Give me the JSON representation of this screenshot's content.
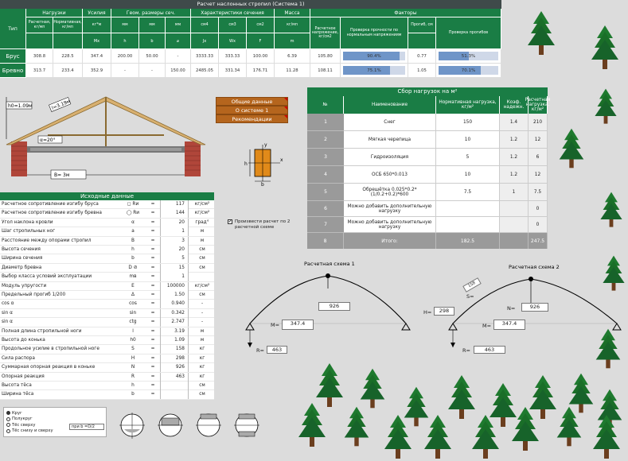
{
  "results": {
    "title": "Расчет наслонных стропил (Система 1)",
    "groups": [
      "Тип",
      "Нагрузки",
      "Усилия",
      "Геом. размеры сеч.",
      "Характеристики сечения",
      "Масса",
      "Факторы"
    ],
    "subheaders": [
      "Расчетная, кг/мп",
      "Нормативная, кг/мп",
      "кг*м",
      "мм",
      "мм",
      "мм",
      "см4",
      "см3",
      "см2",
      "кг/мп",
      "Расчетное напряжение, кг/см2",
      "Проверка прочности по нормальным напряжениям",
      "Прогиб, см",
      "Проверка прогибов"
    ],
    "units": [
      "",
      "",
      "Мх",
      "h",
      "b",
      "⌀",
      "Jx",
      "Wx",
      "F",
      "m",
      "",
      "",
      "",
      ""
    ],
    "rows": [
      {
        "type": "Брус",
        "cells": [
          "308.8",
          "228.5",
          "347.4",
          "200.00",
          "50.00",
          "-",
          "3333.33",
          "333.33",
          "100.00",
          "6.39",
          "105.80",
          "",
          "0.77",
          ""
        ],
        "stress_pct": "90.4%",
        "stress_value": 0.904,
        "defl_pct": "51.3%",
        "defl_value": 0.513
      },
      {
        "type": "Бревно",
        "cells": [
          "313.7",
          "233.4",
          "352.9",
          "-",
          "-",
          "150.00",
          "2485.05",
          "331.34",
          "176.71",
          "11.28",
          "108.11",
          "",
          "1.05",
          ""
        ],
        "stress_pct": "75.1%",
        "stress_value": 0.751,
        "defl_pct": "70.1%",
        "defl_value": 0.701
      }
    ]
  },
  "buttons": {
    "general": "Общие данные",
    "about": "О системе 1",
    "recommend": "Рекомендации"
  },
  "diagram": {
    "h0": "h0=1.09м",
    "l": "l=3.19м",
    "alpha": "α=20°",
    "b": "B= 3м"
  },
  "section": {
    "h": "h",
    "b": "b",
    "x": "x",
    "y": "y"
  },
  "inputs": {
    "title": "Исходные данные",
    "rows": [
      {
        "label": "Расчетное сопротивление изгибу бруса",
        "sym": "◻ Rи",
        "eq": "=",
        "val": "117",
        "unit": "кг/см²"
      },
      {
        "label": "Расчетное сопротивление изгибу бревна",
        "sym": "◯ Rи",
        "eq": "=",
        "val": "144",
        "unit": "кг/см²"
      },
      {
        "label": "Угол наклона кровли",
        "sym": "α",
        "eq": "=",
        "val": "20",
        "unit": "град°"
      },
      {
        "label": "Шаг стропильных ног",
        "sym": "а",
        "eq": "=",
        "val": "1",
        "unit": "м"
      },
      {
        "label": "Расстояние между опорами стропил",
        "sym": "В",
        "eq": "=",
        "val": "3",
        "unit": "м"
      },
      {
        "label": "Высота сечения",
        "sym": "h",
        "eq": "=",
        "val": "20",
        "unit": "см"
      },
      {
        "label": "Ширина сечения",
        "sym": "b",
        "eq": "=",
        "val": "5",
        "unit": "см"
      },
      {
        "label": "Диаметр бревна",
        "sym": "D ⊘",
        "eq": "=",
        "val": "15",
        "unit": "см"
      },
      {
        "label": "Выбор класса условий эксплуатации",
        "sym": "mв",
        "eq": "=",
        "val": "1",
        "unit": ""
      },
      {
        "label": "Модуль упругости",
        "sym": "E",
        "eq": "=",
        "val": "100000",
        "unit": "кг/см²"
      },
      {
        "label": "Предельный прогиб 1/200",
        "sym": "Δ",
        "eq": "=",
        "val": "1.50",
        "unit": "см"
      },
      {
        "label": "cos α",
        "sym": "cos",
        "eq": "=",
        "val": "0.940",
        "unit": "-"
      },
      {
        "label": "sin α",
        "sym": "sin",
        "eq": "=",
        "val": "0.342",
        "unit": "-"
      },
      {
        "label": "sin α",
        "sym": "ctg",
        "eq": "=",
        "val": "2.747",
        "unit": "-"
      },
      {
        "label": "Полная длина стропильной ноги",
        "sym": "l",
        "eq": "=",
        "val": "3.19",
        "unit": "м"
      },
      {
        "label": "Высота до конька",
        "sym": "h0",
        "eq": "=",
        "val": "1.09",
        "unit": "м"
      },
      {
        "label": "Продольное усилие в стропильной ноге",
        "sym": "S",
        "eq": "=",
        "val": "158",
        "unit": "кг"
      },
      {
        "label": "Сила распора",
        "sym": "H",
        "eq": "=",
        "val": "298",
        "unit": "кг"
      },
      {
        "label": "Суммарная опорная реакция в коньке",
        "sym": "N",
        "eq": "=",
        "val": "926",
        "unit": "кг"
      },
      {
        "label": "Опорная реакция",
        "sym": "R",
        "eq": "=",
        "val": "463",
        "unit": "кг"
      },
      {
        "label": "Высота тёса",
        "sym": "h",
        "eq": "=",
        "val": "",
        "unit": "см"
      },
      {
        "label": "Ширина тёса",
        "sym": "b",
        "eq": "=",
        "val": "",
        "unit": "см"
      }
    ]
  },
  "checkbox_label": "Произвести расчет по 2 расчетной схеме",
  "options": [
    "Круг",
    "Полукруг",
    "Тёс сверху",
    "Тёс снизу и сверху"
  ],
  "options_dropdown": "при b =D/2",
  "loads": {
    "title": "Сбор нагрузок на м²",
    "headers": [
      "№",
      "Наименование",
      "Нормативная нагрузка, кг/м²",
      "Коэф. надежн.",
      "Расчетная нагрузка, кг/м²"
    ],
    "rows": [
      {
        "n": "1",
        "name": "Снег",
        "norm": "150",
        "k": "1.4",
        "calc": "210"
      },
      {
        "n": "2",
        "name": "Мягкая черепица",
        "norm": "10",
        "k": "1.2",
        "calc": "12"
      },
      {
        "n": "3",
        "name": "Гидроизоляция",
        "norm": "5",
        "k": "1.2",
        "calc": "6"
      },
      {
        "n": "4",
        "name": "ОСБ 650*0.013",
        "norm": "10",
        "k": "1.2",
        "calc": "12"
      },
      {
        "n": "5",
        "name": "Обрешётка 0.025*0.2*(1/0.2+0.2)*600",
        "norm": "7.5",
        "k": "1",
        "calc": "7.5"
      },
      {
        "n": "6",
        "name": "Можно добавить дополнительную нагрузку",
        "norm": "",
        "k": "",
        "calc": "0"
      },
      {
        "n": "7",
        "name": "Можно добавить дополнительную нагрузку",
        "norm": "",
        "k": "",
        "calc": "0"
      }
    ],
    "total": {
      "n": "8",
      "name": "Итого:",
      "norm": "182.5",
      "calc": "247.5"
    }
  },
  "scheme1": {
    "title": "Расчетная схема 1",
    "n": "926",
    "m_label": "M=",
    "m": "347.4",
    "r_label": "R=",
    "r": "463"
  },
  "scheme2": {
    "title": "Расчетная схема 2",
    "s_label": "S=",
    "s": "158",
    "h_label": "H=",
    "h": "298",
    "n_label": "N=",
    "n": "926",
    "m_label": "M=",
    "m": "347.4",
    "r_label": "R=",
    "r": "463"
  },
  "colors": {
    "header": "#1a7d45",
    "title": "#3f4a4a",
    "button": "#b5651d",
    "bar": "#6f95c8"
  }
}
